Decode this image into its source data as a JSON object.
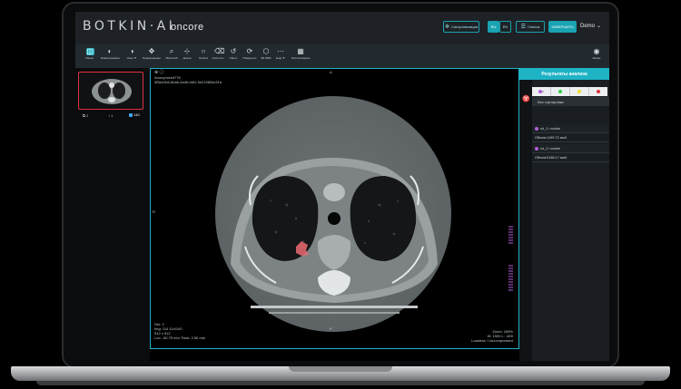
{
  "app": {
    "logo": "BOTKIN·AI",
    "product": "oncore",
    "user": "Demo"
  },
  "topbar_buttons": [
    {
      "icon": "hub-icon",
      "label": "Синхронизация",
      "style": "outline"
    },
    {
      "icon": "",
      "label": "RU",
      "style": "filled"
    },
    {
      "icon": "",
      "label": "EN",
      "style": "outline"
    },
    {
      "icon": "list-icon",
      "label": "Список",
      "style": "outline"
    },
    {
      "icon": "",
      "label": "ЗАВЕРШИТЬ",
      "style": "filled"
    }
  ],
  "toolbar": [
    {
      "icon": "overlay-icon",
      "label": "Оверл.",
      "active": true
    },
    {
      "icon": "contrast-icon",
      "label": "Инвертировать"
    },
    {
      "icon": "window-level-icon",
      "label": "Окно ▼"
    },
    {
      "icon": "move-icon",
      "label": "Перемещение"
    },
    {
      "icon": "zoom-icon",
      "label": "Масштаб"
    },
    {
      "icon": "measure-icon",
      "label": "Длина"
    },
    {
      "icon": "ellipse-icon",
      "label": "Эллипс"
    },
    {
      "icon": "eraser-icon",
      "label": "Очистить"
    },
    {
      "icon": "reset-icon",
      "label": "Сброс"
    },
    {
      "icon": "rotate-icon",
      "label": "Повернуть"
    },
    {
      "icon": "cube-icon",
      "label": "3D MPR"
    },
    {
      "icon": "more-icon",
      "label": "Ещё ▼"
    },
    {
      "icon": "grid-icon",
      "label": "Расположение"
    }
  ],
  "toolbar_right": {
    "icon": "eye-icon",
    "label": "Маски"
  },
  "thumbnail": {
    "series": "2",
    "frames": "1",
    "count": "140"
  },
  "viewport": {
    "top_left": [
      "Anonymized776",
      "3f5a41b6-6bab-4a4b-bbf1-9e21980dc31a"
    ],
    "top_center": "A",
    "left_center": "R",
    "bottom_center": "P",
    "bottom_left": [
      "Ser: 2",
      "Img: 114 114/140",
      "512 x 512",
      "Loc: -50.75 mm Thick: 2.50 mm"
    ],
    "bottom_right": [
      "Zoom: 165%",
      "W: 1500 L: -600",
      "Lossless / Uncompressed"
    ]
  },
  "results": {
    "title": "Результаты анализа",
    "filters": [
      {
        "color": "#b45ddc",
        "label": "2"
      },
      {
        "color": "#2fd14a",
        "label": ""
      },
      {
        "color": "#f1dd2c",
        "label": ""
      },
      {
        "color": "#e0313f",
        "label": ""
      }
    ],
    "unsorted_label": "Без сортировки",
    "rois": [
      {
        "name": "roi_1: nodule",
        "volume": "Объем:1199.72 мм3",
        "color": "#b45ddc"
      },
      {
        "name": "roi_2: nodule",
        "volume": "Объем:5188.17 мм3",
        "color": "#b45ddc"
      }
    ]
  },
  "colors": {
    "accent": "#1fb3c6",
    "alert": "#e0313f",
    "bg": "#1e2226"
  }
}
